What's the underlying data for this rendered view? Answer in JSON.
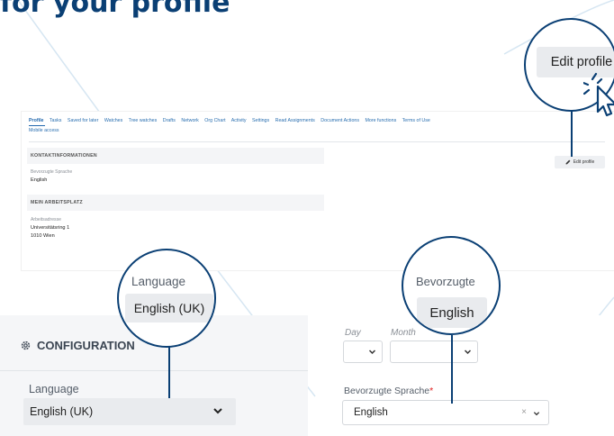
{
  "title": "for your profile",
  "profile": {
    "tabs": [
      "Profile",
      "Tasks",
      "Saved for later",
      "Watches",
      "Tree watches",
      "Drafts",
      "Network",
      "Org Chart",
      "Activity",
      "Settings",
      "Read Assignments",
      "Document Actions",
      "More functions",
      "Terms of Use",
      "Mobile access"
    ],
    "edit_button": "Edit profile",
    "contact_heading": "KONTAKTINFORMATIONEN",
    "preferred_language_label": "Bevorzugte Sprache",
    "preferred_language_value": "English",
    "workplace_heading": "MEIN ARBEITSPLATZ",
    "work_address_label": "Arbeitsadresse",
    "work_address_line1": "Universitätsring 1",
    "work_address_line2": "1010 Wien"
  },
  "zoom_edit": {
    "label": "Edit profile"
  },
  "zoom_language": {
    "label": "Language",
    "value": "English (UK)"
  },
  "zoom_bevorzugte": {
    "label": "Bevorzugte",
    "value": "English"
  },
  "configuration": {
    "heading": "CONFIGURATION",
    "language_label": "Language",
    "language_value": "English (UK)"
  },
  "form": {
    "day_label": "Day",
    "month_label": "Month",
    "preferred_language_label": "Bevorzugte Sprache",
    "required_marker": "*",
    "preferred_language_value": "English",
    "clear_symbol": "×"
  },
  "colors": {
    "accent": "#0a3f74",
    "link": "#2a6fb0",
    "panel": "#f5f6f8"
  }
}
